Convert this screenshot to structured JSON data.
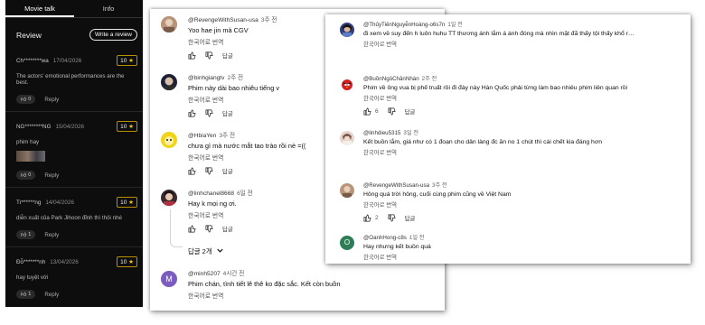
{
  "left_panel": {
    "tabs": [
      "Movie talk",
      "Info"
    ],
    "review_title": "Review",
    "write_review": "Write a review",
    "reviews": [
      {
        "user": "Ch********wa",
        "date": "17/04/2026",
        "score": "10",
        "text": "The actors' emotional performances are the best.",
        "likes": "0",
        "reply": "Reply"
      },
      {
        "user": "NG********NG",
        "date": "15/04/2026",
        "score": "10",
        "text": "phim hay",
        "likes": "0",
        "reply": "Reply"
      },
      {
        "user": "Tr******ng",
        "date": "14/04/2026",
        "score": "10",
        "text": "diễn xuất của Park Jihoon đỉnh thì thôi nhé",
        "likes": "1",
        "reply": "Reply"
      },
      {
        "user": "Đỗ*******nh",
        "date": "13/04/2026",
        "score": "10",
        "text": "hay tuyệt vời",
        "likes": "1",
        "reply": "Reply"
      }
    ]
  },
  "middle_card": {
    "comments": [
      {
        "handle": "@RevengeWithSusan-usa",
        "time": "3주 전",
        "text": "Yoo hae jin mà CGV",
        "translate": "한국어로 번역",
        "reply": "답글",
        "likes": ""
      },
      {
        "handle": "@binhgiangtv",
        "time": "2주 전",
        "text": "Phim này dài bao nhiêu tiếng v",
        "translate": "한국어로 번역",
        "reply": "답글",
        "likes": ""
      },
      {
        "handle": "@HbiaYen",
        "time": "3주 전",
        "text": "chưa gì mà nước mắt tao trào rồi nè =((",
        "translate": "한국어로 번역",
        "reply": "답글",
        "likes": ""
      },
      {
        "handle": "@linhchanel8668",
        "time": "6일 전",
        "text": "Hay k mọi ng ơi.",
        "translate": "한국어로 번역",
        "reply": "답글",
        "likes": ""
      },
      {
        "handle": "@minh5207",
        "time": "4시간 전",
        "text": "Phim chán, tình tiết lê thê ko đặc sắc. Kết còn buồn",
        "translate": "한국어로 번역",
        "reply": "",
        "likes": ""
      }
    ],
    "reply_count": "답글 2개",
    "avatar_letter": "M"
  },
  "right_card": {
    "comments": [
      {
        "handle": "@ThủyTiênNguyễnHoàng-o6s7n",
        "time": "1일 전",
        "text": "đi xem về suy đến h luôn huhu TT thương ánh lắm á ánh đóng mà nhìn mặt đã thấy tội thấy khổ r…",
        "translate": "한국어로 번역",
        "reply": "",
        "likes": ""
      },
      {
        "handle": "@BuồnNgủChănNhàn",
        "time": "2주 전",
        "text": "Phim về ông vua bị phế truất rồi đi đày này Hàn Quốc phải từng làm bao nhiêu phim liên quan rồi",
        "translate": "한국어로 번역",
        "reply": "답글",
        "likes": "6"
      },
      {
        "handle": "@linhdieu5315",
        "time": "3일 전",
        "text": "Kết buồn lắm, giá như có 1 đoạn cho dân làng đc ăn no 1 chút thì cái chết kia đáng hơn",
        "translate": "한국어로 번역",
        "reply": "",
        "likes": ""
      },
      {
        "handle": "@RevengeWithSusan-usa",
        "time": "3주 전",
        "text": "Hông quá trời hông, cuối cùng phim cũng về Việt Nam",
        "translate": "한국어로 번역",
        "reply": "답글",
        "likes": "2"
      },
      {
        "handle": "@OanhHong-c8s",
        "time": "1일 전",
        "text": "Hay nhưng kết buồn quá",
        "translate": "한국어로 번역",
        "reply": "",
        "likes": ""
      }
    ],
    "avatar_letter": "O"
  },
  "colors": {
    "dark_bg": "#0d0d0d",
    "score_border": "#b88f00",
    "star": "#f5c518",
    "avatar_purple": "#7c5cbf",
    "avatar_green": "#2e7d57"
  },
  "icons": [
    "thumb-up-icon",
    "thumb-down-icon",
    "chevron-down-icon",
    "star-icon"
  ]
}
